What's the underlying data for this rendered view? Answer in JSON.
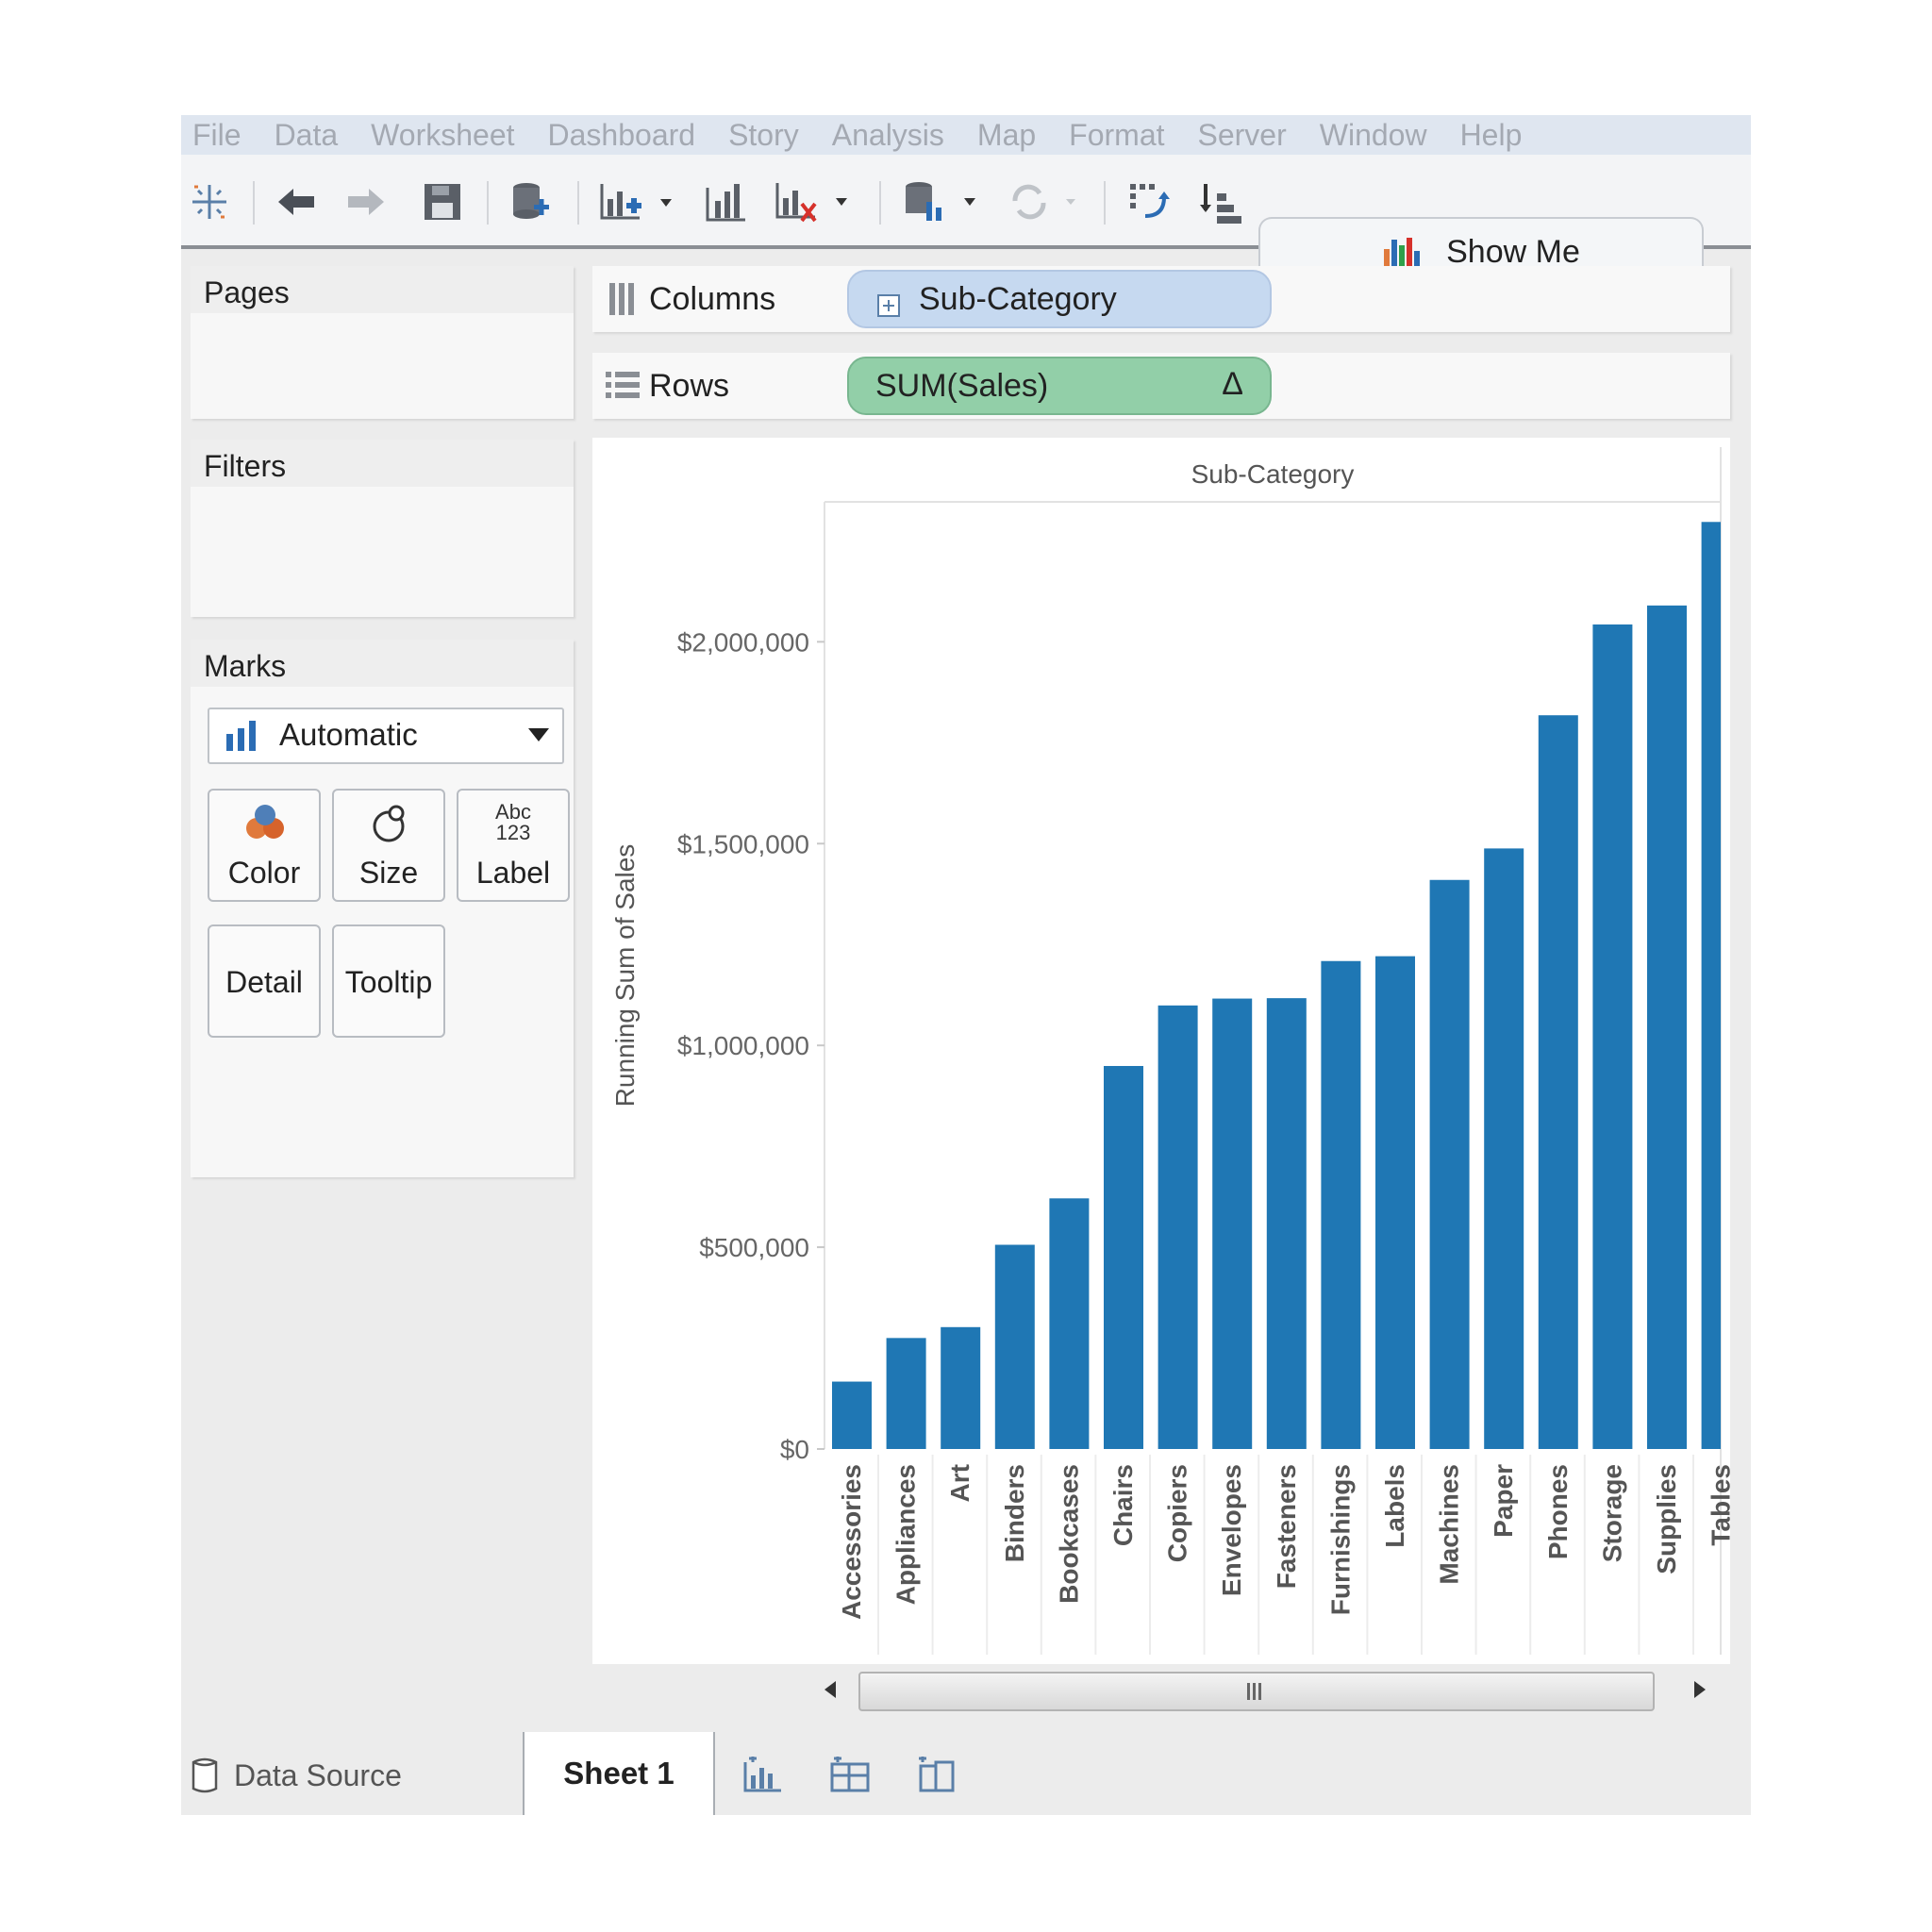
{
  "menu": [
    "File",
    "Data",
    "Worksheet",
    "Dashboard",
    "Story",
    "Analysis",
    "Map",
    "Format",
    "Server",
    "Window",
    "Help"
  ],
  "toolbar": {
    "show_me_label": "Show Me"
  },
  "pages_card": {
    "title": "Pages"
  },
  "filters_card": {
    "title": "Filters"
  },
  "marks_card": {
    "title": "Marks",
    "mark_type": "Automatic",
    "buttons": {
      "color": "Color",
      "size": "Size",
      "label": "Label",
      "detail": "Detail",
      "tooltip": "Tooltip"
    },
    "label_icon_text": [
      "Abc",
      "123"
    ]
  },
  "shelves": {
    "columns": {
      "label": "Columns",
      "pill": "Sub-Category",
      "pill_color": "#c6d9f0"
    },
    "rows": {
      "label": "Rows",
      "pill": "SUM(Sales)",
      "pill_color": "#92cfa8",
      "pill_delta": "Δ"
    }
  },
  "tabs": {
    "data_source": "Data Source",
    "sheet": "Sheet 1"
  },
  "chart_data": {
    "type": "bar",
    "title": "Sub-Category",
    "xlabel": "",
    "ylabel": "Running Sum of Sales",
    "bar_color": "#1f77b4",
    "yticks": [
      {
        "value": 0,
        "label": "$0"
      },
      {
        "value": 500000,
        "label": "$500,000"
      },
      {
        "value": 1000000,
        "label": "$1,000,000"
      },
      {
        "value": 1500000,
        "label": "$1,500,000"
      },
      {
        "value": 2000000,
        "label": "$2,000,000"
      }
    ],
    "ylim": [
      0,
      2300000
    ],
    "categories": [
      "Accessories",
      "Appliances",
      "Art",
      "Binders",
      "Bookcases",
      "Chairs",
      "Copiers",
      "Envelopes",
      "Fasteners",
      "Furnishings",
      "Labels",
      "Machines",
      "Paper",
      "Phones",
      "Storage",
      "Supplies",
      "Tables"
    ],
    "values": [
      167000,
      275000,
      302000,
      506000,
      621000,
      949000,
      1099000,
      1116000,
      1117000,
      1209000,
      1221000,
      1410000,
      1488000,
      1818000,
      2043000,
      2090000,
      2297000
    ]
  }
}
